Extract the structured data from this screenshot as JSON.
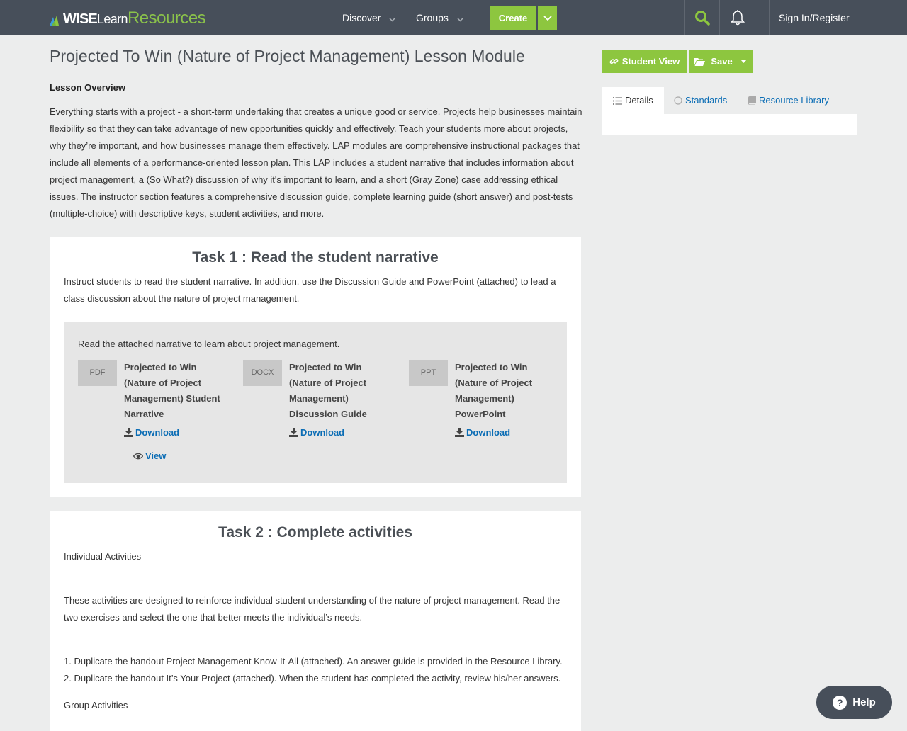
{
  "header": {
    "logo": {
      "wise": "WISE",
      "learn": "Learn",
      "resources": "Resources"
    },
    "nav": {
      "discover": "Discover",
      "groups": "Groups",
      "create": "Create"
    },
    "signin": "Sign In/Register",
    "icons": {
      "search": "search-icon",
      "bell": "bell-icon"
    }
  },
  "page": {
    "title": "Projected To Win (Nature of Project Management) Lesson Module",
    "overview_label": "Lesson Overview",
    "overview_text": "Everything starts with a project - a short-term undertaking that creates a unique good or service. Projects help businesses maintain flexibility so that they can take advantage of new opportunities quickly and effectively. Teach your students more about projects, why they’re important, and how businesses manage them effectively. LAP modules are comprehensive instructional packages that include all elements of a performance-oriented lesson plan. This LAP includes a student narrative that includes information about project management, a (So What?) discussion of why it's important to learn, and a short (Gray Zone) case addressing ethical issues. The instructor section features a comprehensive discussion guide, complete learning guide (short answer) and post-tests (multiple-choice) with descriptive keys, student activities, and more."
  },
  "task1": {
    "title": "Task 1 : Read the student narrative",
    "text": "Instruct students to read the student narrative. In addition, use the Discussion Guide and PowerPoint (attached) to lead a class discussion about the nature of project management.",
    "attach_intro": "Read the attached narrative to learn about project management.",
    "files": [
      {
        "type": "PDF",
        "name": "Projected to Win (Nature of Project Management) Student Narrative",
        "download": "Download",
        "view": "View"
      },
      {
        "type": "DOCX",
        "name": "Projected to Win (Nature of Project Management) Discussion Guide",
        "download": "Download"
      },
      {
        "type": "PPT",
        "name": "Projected to Win (Nature of Project Management) PowerPoint",
        "download": "Download"
      }
    ]
  },
  "task2": {
    "title": "Task 2 : Complete activities",
    "individual_label": "Individual Activities",
    "intro": "These activities are designed to reinforce individual student understanding of the nature of project management. Read the two exercises and select the one that better meets the individual’s needs.",
    "item1": "1. Duplicate the handout Project Management Know-It-All (attached). An answer guide is provided in the Resource Library.",
    "item2": "2. Duplicate the handout It’s Your Project (attached). When the student has completed the activity, review his/her answers.",
    "group_label": "Group Activities"
  },
  "sidebar": {
    "student_view": "Student View",
    "save": "Save",
    "tabs": {
      "details": "Details",
      "standards": "Standards",
      "library": "Resource Library"
    }
  },
  "help": "Help",
  "colors": {
    "header": "#474f5a",
    "accent": "#8dc63f",
    "link": "#0b6db5"
  }
}
